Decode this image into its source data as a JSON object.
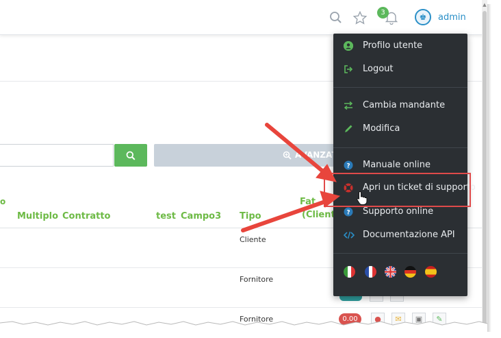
{
  "header": {
    "notification_count": "3",
    "username": "admin",
    "icons": [
      "search-icon",
      "star-icon",
      "bell-icon",
      "user-avatar-icon"
    ]
  },
  "search": {
    "placeholder": "",
    "advanced_label": "AVANZAT"
  },
  "table": {
    "partial_top_label": "o",
    "headers": {
      "multiplo": "Multiplo",
      "contratto": "Contratto",
      "test": "test",
      "campo3": "Campo3",
      "tipo": "Tipo",
      "fat": "Fat",
      "cliente": "(Cliente"
    },
    "rows": [
      {
        "tipo": "Cliente"
      },
      {
        "tipo": "Fornitore"
      },
      {
        "tipo": "Fornitore",
        "amount": "0.00"
      }
    ]
  },
  "user_menu": {
    "groups": [
      [
        {
          "label": "Profilo utente",
          "icon": "user-circle-icon"
        },
        {
          "label": "Logout",
          "icon": "sign-out-icon"
        }
      ],
      [
        {
          "label": "Cambia mandante",
          "icon": "exchange-icon"
        },
        {
          "label": "Modifica",
          "icon": "pencil-icon"
        }
      ],
      [
        {
          "label": "Manuale online",
          "icon": "question-circle-icon"
        },
        {
          "label": "Apri un ticket di supporto",
          "icon": "support-icon"
        },
        {
          "label": "Supporto online",
          "icon": "question-circle-icon"
        },
        {
          "label": "Documentazione API",
          "icon": "code-icon"
        }
      ]
    ],
    "languages": [
      "it",
      "fr",
      "en",
      "de",
      "es"
    ]
  },
  "colors": {
    "accent_green": "#6dba45",
    "menu_background": "#2b2f33",
    "username_blue": "#2a8fc7",
    "highlight_red": "#e04a4a",
    "annotation_arrow_red": "#e8453c"
  }
}
